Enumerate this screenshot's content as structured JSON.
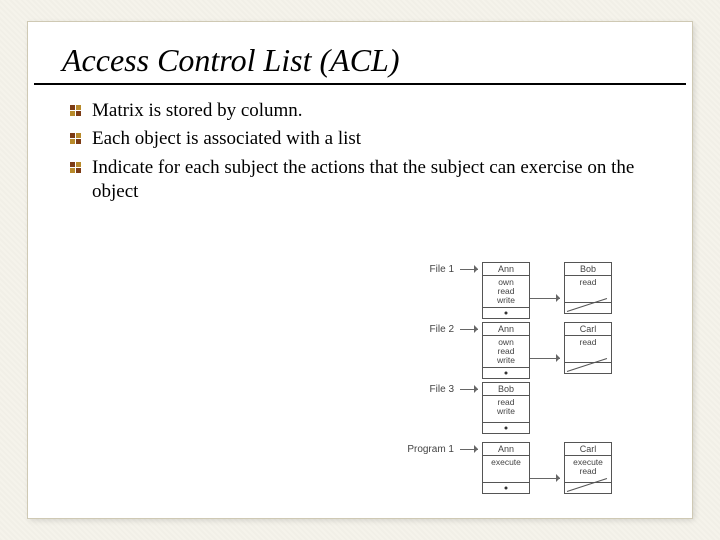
{
  "title": "Access Control List (ACL)",
  "bullets": [
    "Matrix is stored by column.",
    "Each object is associated with a list",
    "Indicate for each subject the actions that the subject can exercise on the object"
  ],
  "diagram": {
    "rows": [
      {
        "label": "File 1",
        "nodes": [
          {
            "name": "Ann",
            "perms": "own\nread\nwrite",
            "ptr": "dot"
          },
          {
            "name": "Bob",
            "perms": "read",
            "ptr": "end"
          }
        ]
      },
      {
        "label": "File 2",
        "nodes": [
          {
            "name": "Ann",
            "perms": "own\nread\nwrite",
            "ptr": "dot"
          },
          {
            "name": "Carl",
            "perms": "read",
            "ptr": "end"
          }
        ]
      },
      {
        "label": "File 3",
        "nodes": [
          {
            "name": "Bob",
            "perms": "read\nwrite",
            "ptr": "dot"
          }
        ]
      },
      {
        "label": "Program 1",
        "nodes": [
          {
            "name": "Ann",
            "perms": "execute",
            "ptr": "dot"
          },
          {
            "name": "Carl",
            "perms": "execute\nread",
            "ptr": "end"
          }
        ]
      }
    ]
  }
}
